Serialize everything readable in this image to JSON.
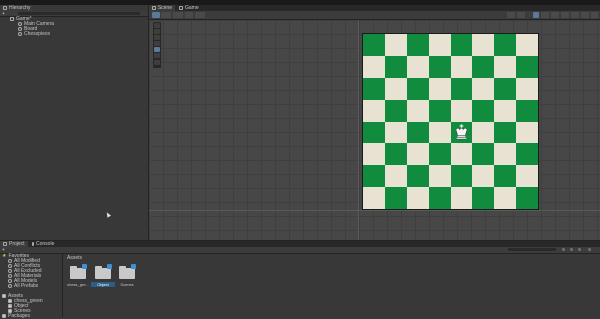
{
  "hierarchy": {
    "tab_label": "Hierarchy",
    "items": [
      {
        "label": "Game*",
        "level": 0
      },
      {
        "label": "Main Camera",
        "level": 1
      },
      {
        "label": "Board",
        "level": 1
      },
      {
        "label": "Chesspiece",
        "level": 1
      }
    ]
  },
  "scene": {
    "tabs": [
      "Scene",
      "Game"
    ]
  },
  "board": {
    "rows": 8,
    "cols": 8,
    "light_color": "#e8e2d3",
    "dark_color": "#118c3e",
    "piece": {
      "name": "white-king",
      "row": 4,
      "col": 4
    }
  },
  "bottom": {
    "tabs": [
      "Project",
      "Console"
    ],
    "favorites_label": "Favorites",
    "favorites": [
      "All Modified",
      "All Conflicts",
      "All Excluded",
      "All Materials",
      "All Models",
      "All Prefabs"
    ],
    "assets_label": "Assets",
    "assets_tree": [
      "chess_green",
      "Object",
      "Scenes"
    ],
    "packages_label": "Packages",
    "breadcrumb": "Assets",
    "folders": [
      {
        "label": "chess_gre..."
      },
      {
        "label": "Object"
      },
      {
        "label": "Scenes"
      }
    ]
  }
}
